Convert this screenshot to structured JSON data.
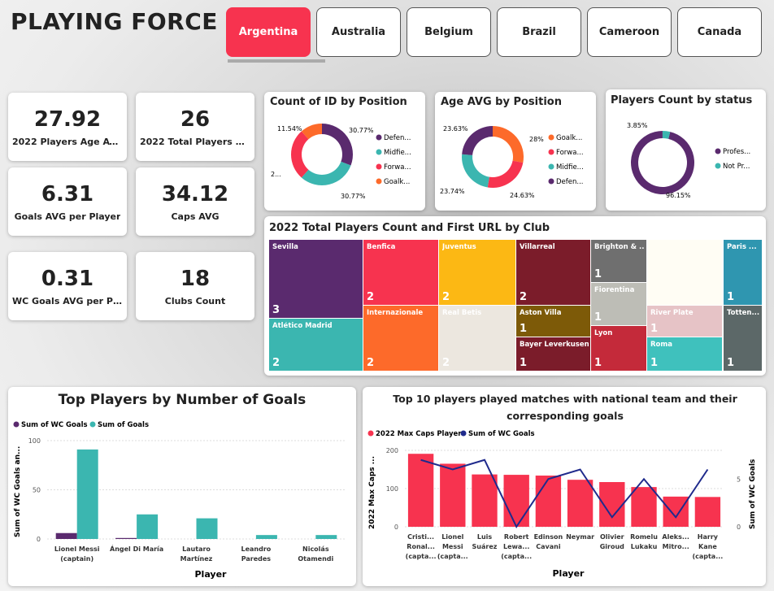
{
  "header": {
    "title": "PLAYING FORCE"
  },
  "tabs": [
    "Argentina",
    "Australia",
    "Belgium",
    "Brazil",
    "Cameroon",
    "Canada"
  ],
  "active_tab": "Argentina",
  "kpis": [
    {
      "value": "27.92",
      "label": "2022 Players Age AVG"
    },
    {
      "value": "26",
      "label": "2022 Total Players Co..."
    },
    {
      "value": "6.31",
      "label": "Goals AVG per Player"
    },
    {
      "value": "34.12",
      "label": "Caps AVG"
    },
    {
      "value": "0.31",
      "label": "WC Goals AVG per Pla..."
    },
    {
      "value": "18",
      "label": "Clubs Count"
    }
  ],
  "colors": {
    "accent": "#f7334f",
    "purple": "#5a2a6e",
    "teal": "#3bb6b0",
    "orange": "#fd6a2a",
    "red": "#f7334f"
  },
  "donut_position": {
    "title": "Count of ID by Position",
    "labels": [
      "11.54%",
      "30.77%",
      "2...",
      "30.77%"
    ],
    "legend": [
      "Defen...",
      "Midfie...",
      "Forwa...",
      "Goalk..."
    ],
    "chart_data": {
      "type": "pie",
      "series": [
        {
          "values": [
            30.77,
            30.77,
            26.92,
            11.54
          ]
        }
      ],
      "categories": [
        "Defender",
        "Midfielder",
        "Forward",
        "Goalkeeper"
      ]
    }
  },
  "donut_age": {
    "title": "Age AVG by Position",
    "labels": [
      "23.63%",
      "28%",
      "23.74%",
      "24.63%"
    ],
    "legend": [
      "Goalk...",
      "Forwa...",
      "Midfie...",
      "Defen..."
    ],
    "chart_data": {
      "type": "pie",
      "series": [
        {
          "values": [
            28,
            24.63,
            23.74,
            23.63
          ]
        }
      ],
      "categories": [
        "Goalkeeper",
        "Forward",
        "Midfielder",
        "Defender"
      ]
    }
  },
  "donut_status": {
    "title": "Players Count by status",
    "labels": [
      "3.85%",
      "96.15%"
    ],
    "legend": [
      "Profes...",
      "Not Pr..."
    ],
    "chart_data": {
      "type": "pie",
      "series": [
        {
          "values": [
            96.15,
            3.85
          ]
        }
      ],
      "categories": [
        "Professional",
        "Not Professional"
      ]
    }
  },
  "treemap": {
    "title": "2022 Total Players Count and First URL by Club",
    "chart_data": {
      "type": "table",
      "items": [
        {
          "name": "Sevilla",
          "value": 3
        },
        {
          "name": "Atlético Madrid",
          "value": 2
        },
        {
          "name": "Benfica",
          "value": 2
        },
        {
          "name": "Internazionale",
          "value": 2
        },
        {
          "name": "Juventus",
          "value": 2
        },
        {
          "name": "Real Betis",
          "value": 2
        },
        {
          "name": "Villarreal",
          "value": 2
        },
        {
          "name": "Aston Villa",
          "value": 1
        },
        {
          "name": "Bayer Leverkusen",
          "value": 1
        },
        {
          "name": "Brighton & ...",
          "value": 1
        },
        {
          "name": "Fiorentina",
          "value": 1
        },
        {
          "name": "Lyon",
          "value": 1
        },
        {
          "name": "River Plate",
          "value": 1
        },
        {
          "name": "Roma",
          "value": 1
        },
        {
          "name": "Paris ...",
          "value": 1
        },
        {
          "name": "Totten...",
          "value": 1
        }
      ]
    }
  },
  "goals_chart": {
    "title": "Top Players by Number of Goals",
    "legend": [
      "Sum of WC Goals",
      "Sum of Goals"
    ],
    "ylabel": "Sum of WC Goals an...",
    "xlabel": "Player",
    "yticks": [
      "100",
      "50",
      "0"
    ],
    "chart_data": {
      "type": "bar",
      "categories": [
        "Lionel Messi (captain)",
        "Ángel Di María",
        "Lautaro Martínez",
        "Leandro Paredes",
        "Nicolás Otamendi"
      ],
      "series": [
        {
          "name": "Sum of WC Goals",
          "values": [
            6,
            1,
            0,
            0,
            0
          ]
        },
        {
          "name": "Sum of Goals",
          "values": [
            91,
            25,
            21,
            4,
            4
          ]
        }
      ],
      "ylim": [
        0,
        100
      ]
    }
  },
  "caps_chart": {
    "title": "Top 10 players played matches with national team and their corresponding goals",
    "legend": [
      "2022 Max Caps Player",
      "Sum of WC Goals"
    ],
    "ylabel_left": "2022 Max Caps ...",
    "ylabel_right": "Sum of WC Goals",
    "xlabel": "Player",
    "yticks_left": [
      "200",
      "100",
      "0"
    ],
    "yticks_right": [
      "5",
      "0"
    ],
    "chart_data": {
      "type": "bar",
      "categories": [
        "Cristi... Ronal... (capta...",
        "Lionel Messi (capta...",
        "Luis Suárez",
        "Robert Lewa... (capta...",
        "Edinson Cavani",
        "Neymar",
        "Olivier Giroud",
        "Romelu Lukaku",
        "Aleks... Mitro...",
        "Harry Kane (capta..."
      ],
      "series": [
        {
          "name": "2022 Max Caps Player",
          "values": [
            191,
            165,
            137,
            136,
            134,
            123,
            117,
            104,
            79,
            78
          ]
        },
        {
          "name": "Sum of WC Goals",
          "values": [
            7,
            6,
            7,
            0,
            5,
            6,
            1,
            5,
            1,
            6
          ]
        }
      ],
      "ylim": [
        0,
        200
      ],
      "y2lim": [
        0,
        8
      ]
    }
  }
}
